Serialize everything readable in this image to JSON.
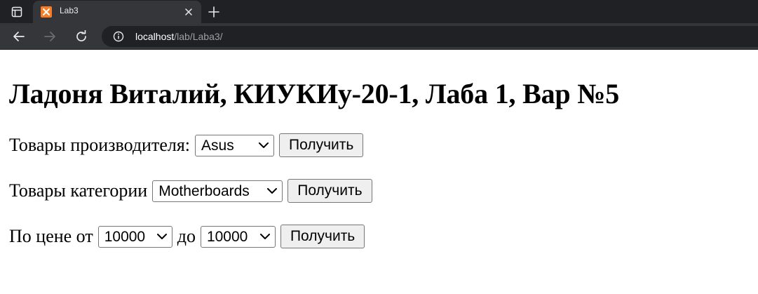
{
  "browser": {
    "tab_title": "Lab3",
    "url_host": "localhost",
    "url_path": "/lab/Laba3/",
    "favicon_icon": "xampp-logo-icon",
    "favicon_color": "#fb7a24"
  },
  "page": {
    "heading": "Ладоня Виталий, КИУКИу-20-1, Лаба 1, Вар №5",
    "manufacturer": {
      "label": "Товары производителя:",
      "selected": "Asus",
      "button": "Получить"
    },
    "category": {
      "label": "Товары категории",
      "selected": "Motherboards",
      "button": "Получить"
    },
    "price": {
      "label_from": "По цене от",
      "from_selected": "10000",
      "label_to": "до",
      "to_selected": "10000",
      "button": "Получить"
    }
  }
}
